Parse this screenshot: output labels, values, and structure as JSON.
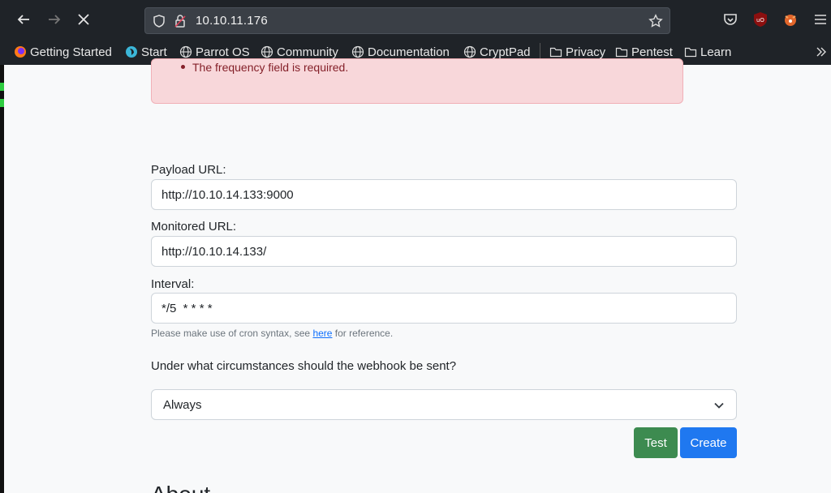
{
  "browser": {
    "url": "10.10.11.176",
    "bookmarks": [
      "Getting Started",
      "Start",
      "Parrot OS",
      "Community",
      "Documentation",
      "CryptPad",
      "Privacy",
      "Pentest",
      "Learn"
    ]
  },
  "alert": {
    "message": "The frequency field is required."
  },
  "form": {
    "payload_label": "Payload URL:",
    "payload_value": "http://10.10.14.133:9000",
    "monitored_label": "Monitored URL:",
    "monitored_value": "http://10.10.14.133/",
    "interval_label": "Interval:",
    "interval_value": "*/5  * * * *",
    "help_prefix": "Please make use of cron syntax, see ",
    "help_link": "here",
    "help_suffix": " for reference.",
    "condition_label": "Under what circumstances should the webhook be sent?",
    "condition_value": "Always",
    "test_label": "Test",
    "create_label": "Create"
  },
  "about_heading": "About"
}
